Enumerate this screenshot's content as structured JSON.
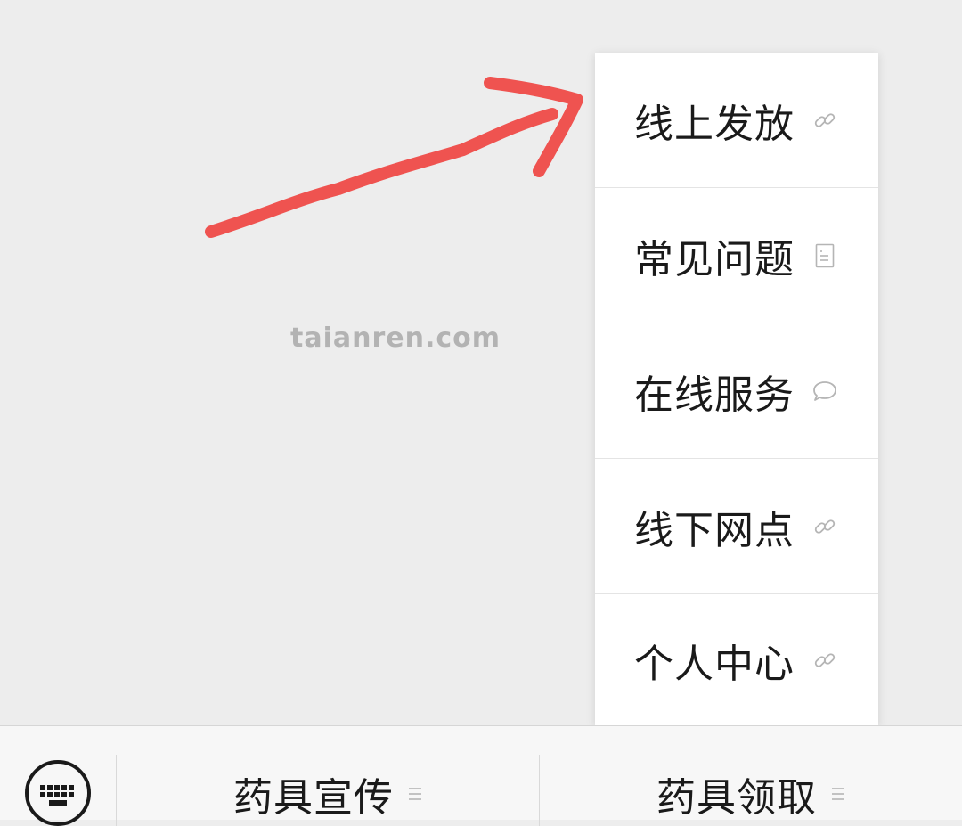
{
  "watermark": "taianren.com",
  "popup_menu": {
    "items": [
      {
        "label": "线上发放",
        "icon": "link-icon"
      },
      {
        "label": "常见问题",
        "icon": "document-icon"
      },
      {
        "label": "在线服务",
        "icon": "chat-bubble-icon"
      },
      {
        "label": "线下网点",
        "icon": "link-icon"
      },
      {
        "label": "个人中心",
        "icon": "link-icon"
      }
    ]
  },
  "bottom_bar": {
    "keyboard_icon": "keyboard-icon",
    "menus": [
      {
        "label": "药具宣传",
        "icon": "menu-lines-icon"
      },
      {
        "label": "药具领取",
        "icon": "menu-lines-icon"
      }
    ]
  },
  "colors": {
    "arrow": "#ef5350",
    "background": "#ededed",
    "menu_text": "#1a1a1a",
    "icon_gray": "#b5b5b5"
  }
}
